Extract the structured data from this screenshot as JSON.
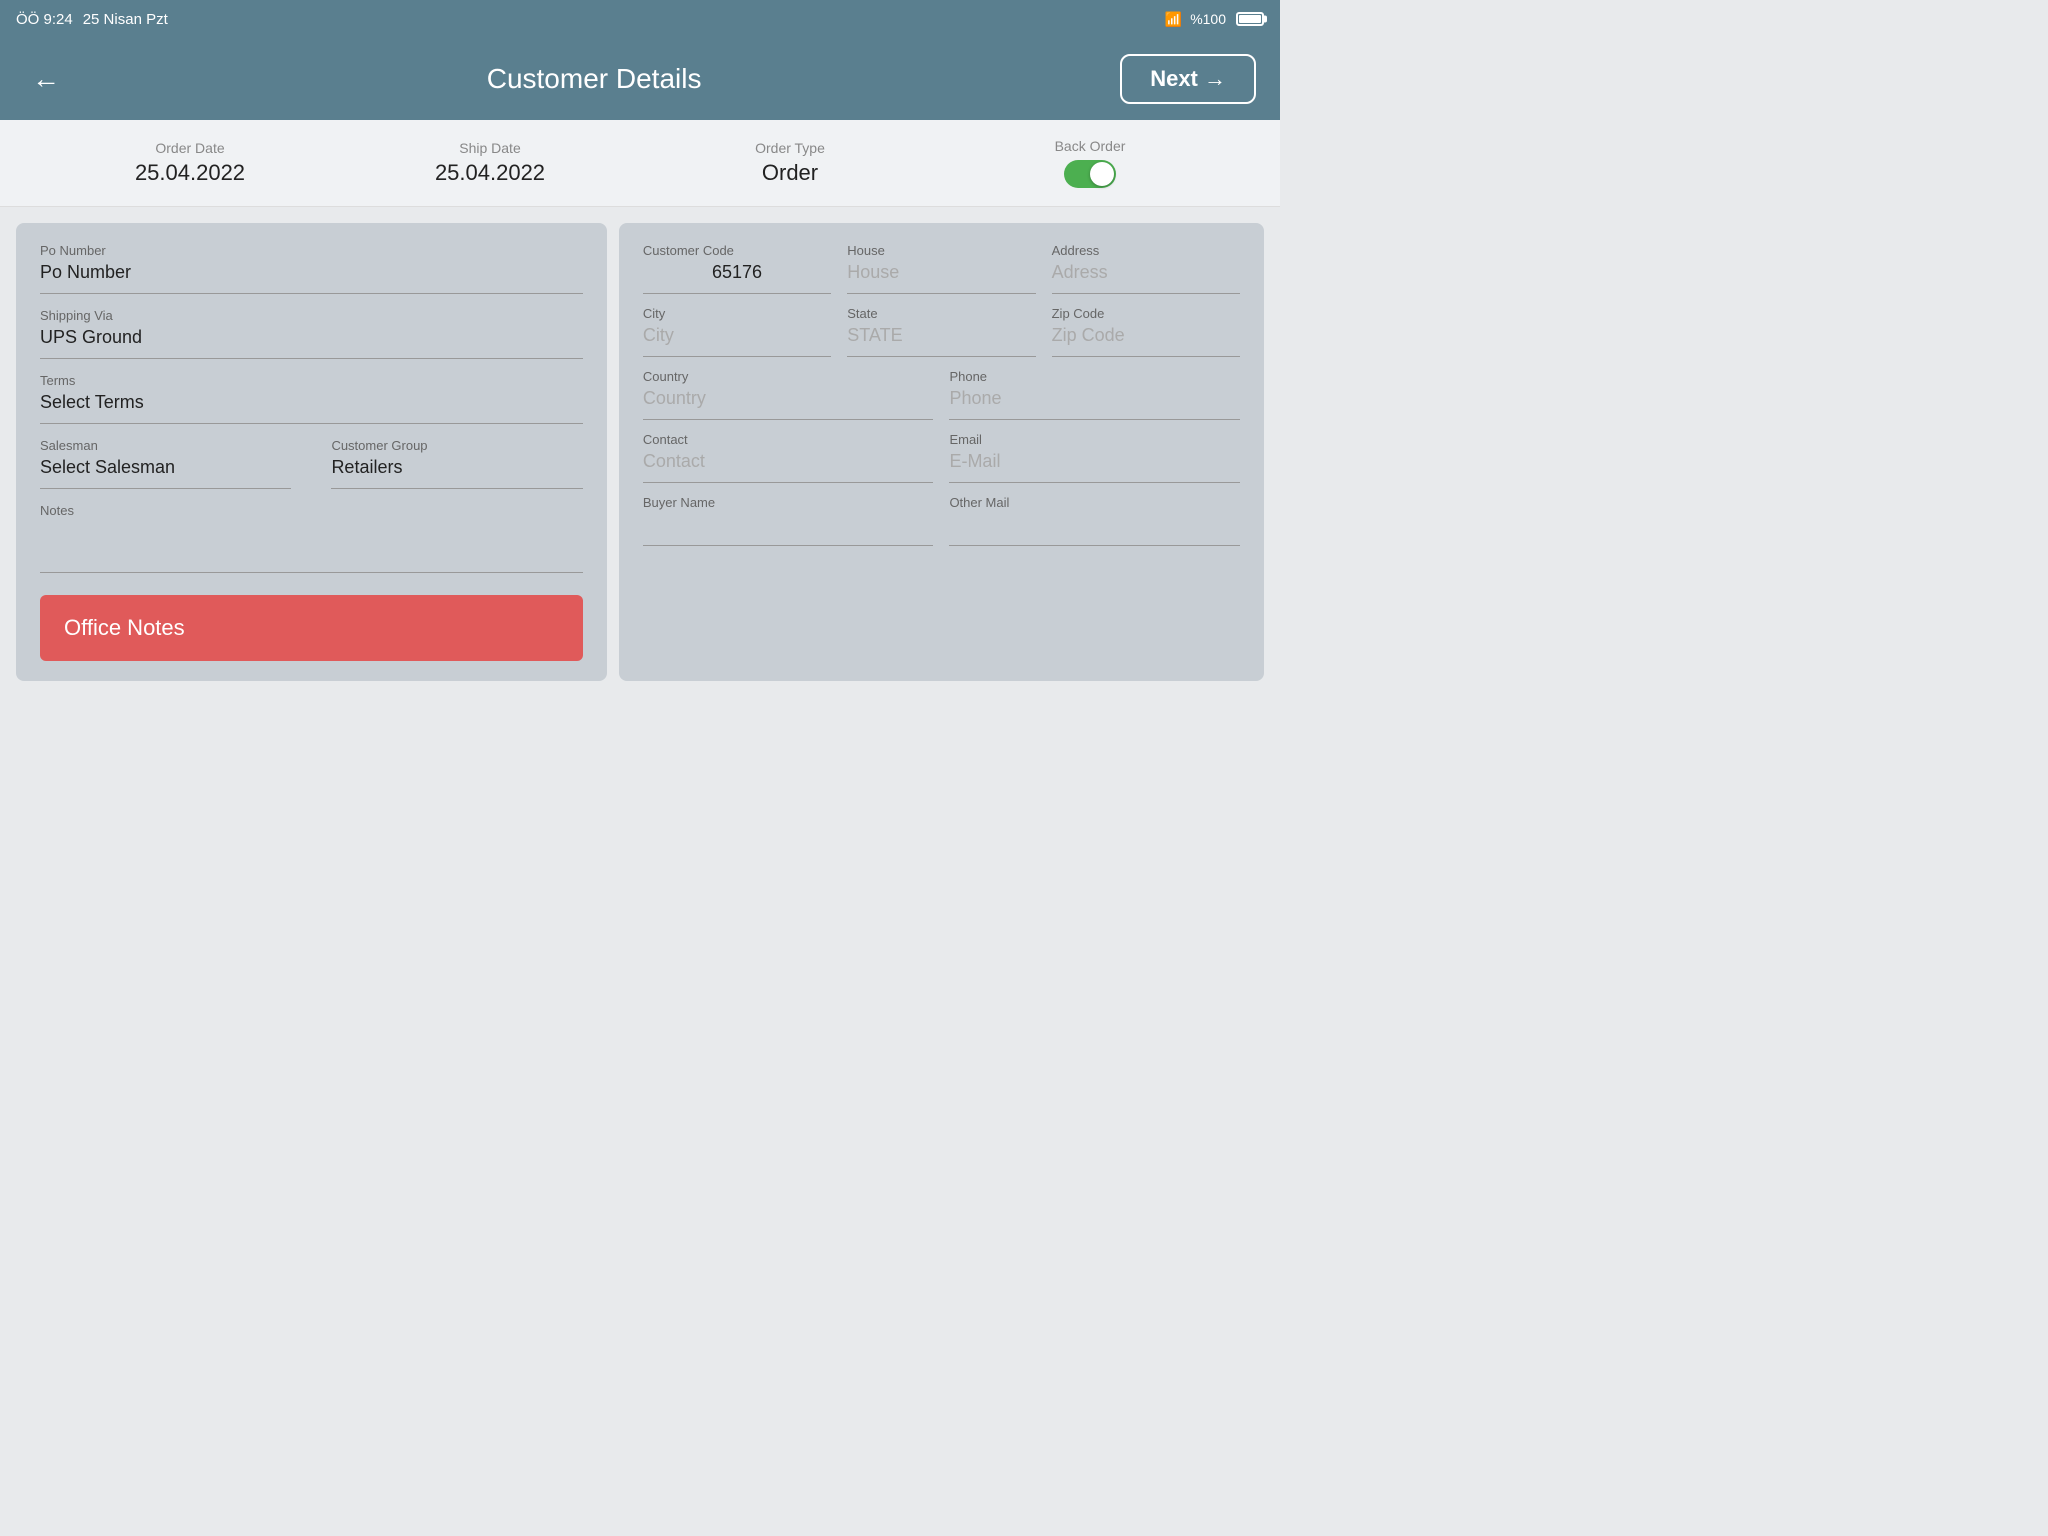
{
  "statusBar": {
    "time": "ÖÖ 9:24",
    "date": "25 Nisan Pzt",
    "signal": "WiFi",
    "battery": "%100"
  },
  "header": {
    "title": "Customer Details",
    "nextLabel": "Next →",
    "backLabel": "←"
  },
  "orderInfo": {
    "orderDateLabel": "Order Date",
    "orderDateValue": "25.04.2022",
    "shipDateLabel": "Ship Date",
    "shipDateValue": "25.04.2022",
    "orderTypeLabel": "Order Type",
    "orderTypeValue": "Order",
    "backOrderLabel": "Back Order",
    "backOrderActive": true
  },
  "leftPanel": {
    "poNumberLabel": "Po Number",
    "poNumberValue": "Po Number",
    "shippingViaLabel": "Shipping Via",
    "shippingViaValue": "UPS Ground",
    "termsLabel": "Terms",
    "termsValue": "Select Terms",
    "salesmanLabel": "Salesman",
    "salesmanValue": "Select Salesman",
    "customerGroupLabel": "Customer Group",
    "customerGroupValue": "Retailers",
    "notesLabel": "Notes",
    "notesValue": "",
    "officeNotesLabel": "Office Notes"
  },
  "rightPanel": {
    "customerCodeLabel": "Customer Code",
    "customerCodeValue": "65176",
    "houseLabel": "House",
    "houseValue": "House",
    "addressLabel": "Address",
    "addressValue": "Adress",
    "cityLabel": "City",
    "cityValue": "City",
    "stateLabel": "State",
    "stateValue": "STATE",
    "zipCodeLabel": "Zip Code",
    "zipCodeValue": "Zip Code",
    "countryLabel": "Country",
    "countryValue": "Country",
    "phoneLabel": "Phone",
    "phoneValue": "Phone",
    "contactLabel": "Contact",
    "contactValue": "Contact",
    "emailLabel": "Email",
    "emailValue": "E-Mail",
    "buyerNameLabel": "Buyer Name",
    "buyerNameValue": "",
    "otherMailLabel": "Other Mail",
    "otherMailValue": ""
  }
}
